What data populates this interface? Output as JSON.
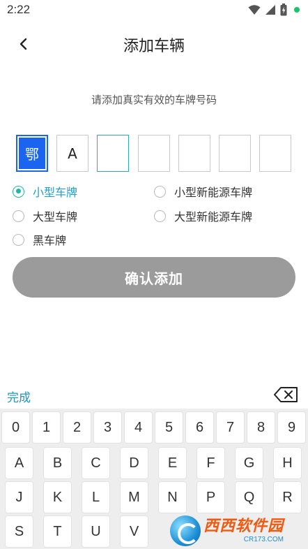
{
  "status_bar": {
    "time": "2:22"
  },
  "header": {
    "title": "添加车辆"
  },
  "form": {
    "hint": "请添加真实有效的车牌号码"
  },
  "plate": {
    "cells": [
      "鄂",
      "A",
      "",
      "",
      "",
      "",
      ""
    ]
  },
  "plate_types": [
    {
      "label": "小型车牌",
      "selected": true
    },
    {
      "label": "小型新能源车牌",
      "selected": false
    },
    {
      "label": "大型车牌",
      "selected": false
    },
    {
      "label": "大型新能源车牌",
      "selected": false
    },
    {
      "label": "黑车牌",
      "selected": false
    }
  ],
  "confirm_button": {
    "label": "确认添加"
  },
  "keyboard": {
    "done_label": "完成",
    "rows": [
      [
        "0",
        "1",
        "2",
        "3",
        "4",
        "5",
        "6",
        "7",
        "8",
        "9"
      ],
      [
        "A",
        "B",
        "C",
        "D",
        "E",
        "F",
        "G",
        "H"
      ],
      [
        "J",
        "K",
        "L",
        "M",
        "N",
        "P",
        "Q",
        "R"
      ],
      [
        "S",
        "T",
        "U",
        "V"
      ]
    ]
  },
  "watermark": {
    "brand": "西西软件园",
    "site": "CR173.COM"
  },
  "colors": {
    "accent": "#1fb5a8",
    "province_bg": "#1a64f0",
    "button_disabled": "#9b9b9b",
    "done_text": "#1f95bd"
  }
}
